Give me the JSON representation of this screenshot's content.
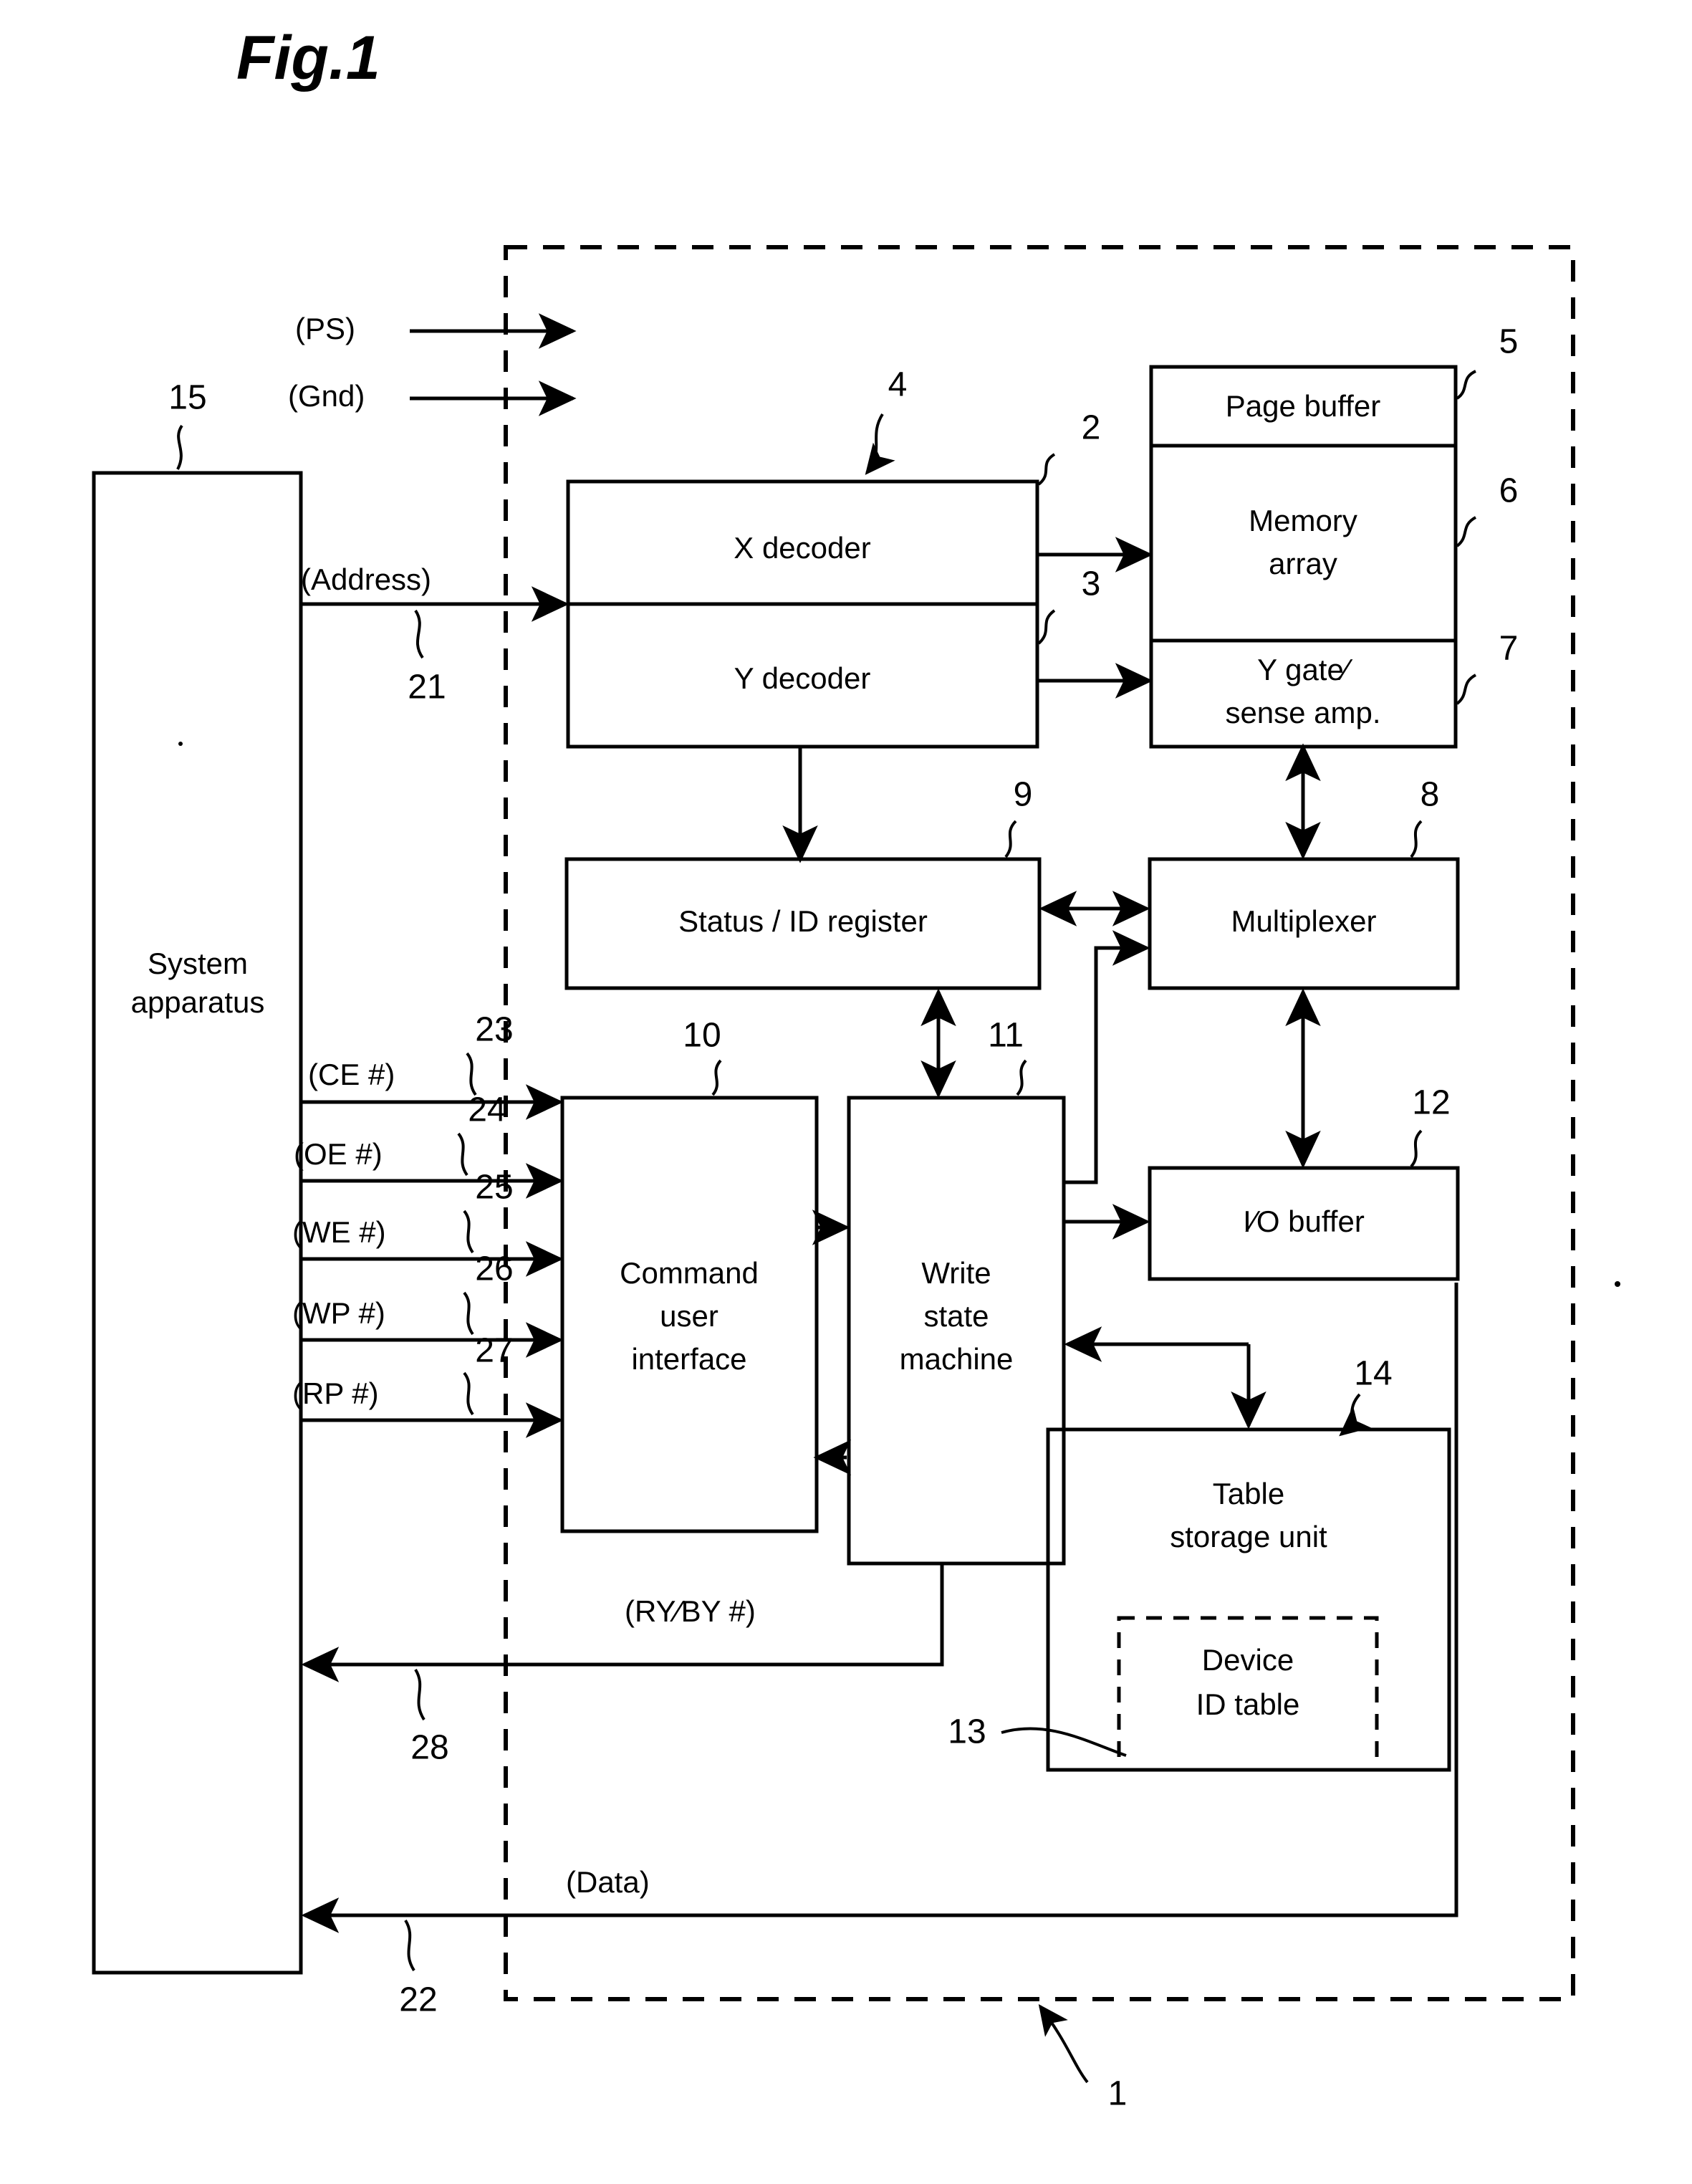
{
  "figure": {
    "title": "Fig.1",
    "caption_ref": "1"
  },
  "blocks": [
    {
      "id": "system-apparatus",
      "label_lines": [
        "System",
        "apparatus"
      ],
      "ref": "15"
    },
    {
      "id": "x-decoder",
      "label_lines": [
        "X  decoder"
      ],
      "ref": "2"
    },
    {
      "id": "y-decoder",
      "label_lines": [
        "Y  decoder"
      ],
      "ref": "3"
    },
    {
      "id": "decoder-group",
      "label_lines": [],
      "ref": "4"
    },
    {
      "id": "page-buffer",
      "label_lines": [
        "Page  buffer"
      ],
      "ref": "5"
    },
    {
      "id": "memory-array",
      "label_lines": [
        "Memory",
        "array"
      ],
      "ref": "6"
    },
    {
      "id": "y-gate-sense-amp",
      "label_lines": [
        "Y gate∕",
        "sense amp."
      ],
      "ref": "7"
    },
    {
      "id": "status-id-register",
      "label_lines": [
        "Status / ID  register"
      ],
      "ref": "9"
    },
    {
      "id": "multiplexer",
      "label_lines": [
        "Multiplexer"
      ],
      "ref": "8"
    },
    {
      "id": "command-user-interface",
      "label_lines": [
        "Command",
        "user",
        "interface"
      ],
      "ref": "10"
    },
    {
      "id": "write-state-machine",
      "label_lines": [
        "Write",
        "state",
        "machine"
      ],
      "ref": "11"
    },
    {
      "id": "io-buffer",
      "label_lines": [
        "I∕O  buffer"
      ],
      "ref": "12"
    },
    {
      "id": "table-storage-unit",
      "label_lines": [
        "Table",
        "storage  unit"
      ],
      "ref": "14"
    },
    {
      "id": "device-id-table",
      "label_lines": [
        "Device",
        "ID  table"
      ],
      "ref": "13"
    }
  ],
  "signals": [
    {
      "id": "ps",
      "label": "(PS)",
      "ref": ""
    },
    {
      "id": "gnd",
      "label": "(Gnd)",
      "ref": ""
    },
    {
      "id": "address",
      "label": "(Address)",
      "ref": "21"
    },
    {
      "id": "ce",
      "label": "(CE #)",
      "ref": "23"
    },
    {
      "id": "oe",
      "label": "(OE #)",
      "ref": "24"
    },
    {
      "id": "we",
      "label": "(WE #)",
      "ref": "25"
    },
    {
      "id": "wp",
      "label": "(WP #)",
      "ref": "26"
    },
    {
      "id": "rp",
      "label": "(RP #)",
      "ref": "27"
    },
    {
      "id": "ry-by",
      "label": "(RY∕BY #)",
      "ref": "28"
    },
    {
      "id": "data",
      "label": "(Data)",
      "ref": "22"
    }
  ],
  "labels": {
    "title": "Fig.1",
    "system_apparatus_1": "System",
    "system_apparatus_2": "apparatus",
    "x_decoder": "X  decoder",
    "y_decoder": "Y  decoder",
    "page_buffer": "Page  buffer",
    "memory_array_1": "Memory",
    "memory_array_2": "array",
    "y_gate_1": "Y gate∕",
    "y_gate_2": "sense amp.",
    "status_id_register": "Status / ID  register",
    "multiplexer": "Multiplexer",
    "cui_1": "Command",
    "cui_2": "user",
    "cui_3": "interface",
    "wsm_1": "Write",
    "wsm_2": "state",
    "wsm_3": "machine",
    "io_buffer": "I∕O  buffer",
    "table_storage_1": "Table",
    "table_storage_2": "storage  unit",
    "device_id_1": "Device",
    "device_id_2": "ID  table",
    "sig_ps": "(PS)",
    "sig_gnd": "(Gnd)",
    "sig_address": "(Address)",
    "sig_ce": "(CE #)",
    "sig_oe": "(OE #)",
    "sig_we": "(WE #)",
    "sig_wp": "(WP #)",
    "sig_rp": "(RP #)",
    "sig_ryby": "(RY∕BY #)",
    "sig_data": "(Data)"
  },
  "refs": {
    "r1": "1",
    "r2": "2",
    "r3": "3",
    "r4": "4",
    "r5": "5",
    "r6": "6",
    "r7": "7",
    "r8": "8",
    "r9": "9",
    "r10": "10",
    "r11": "11",
    "r12": "12",
    "r13": "13",
    "r14": "14",
    "r15": "15",
    "r21": "21",
    "r22": "22",
    "r23": "23",
    "r24": "24",
    "r25": "25",
    "r26": "26",
    "r27": "27",
    "r28": "28"
  },
  "colors": {
    "ink": "#000000",
    "paper": "#ffffff"
  }
}
